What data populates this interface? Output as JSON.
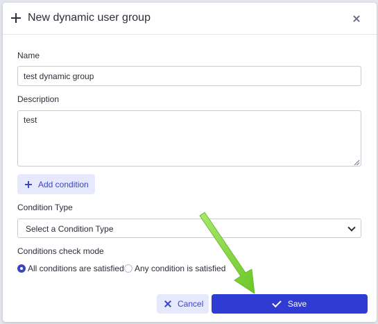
{
  "dialog": {
    "title": "New dynamic user group",
    "close_icon": "close-icon",
    "header_icon": "plus-icon"
  },
  "form": {
    "name_label": "Name",
    "name_value": "test dynamic group",
    "description_label": "Description",
    "description_value": "test",
    "add_condition_label": "Add condition",
    "condition_type_label": "Condition Type",
    "condition_type_selected": "Select a Condition Type",
    "check_mode_label": "Conditions check mode",
    "check_mode_options": [
      {
        "label": "All conditions are satisfied",
        "checked": true
      },
      {
        "label": "Any condition is satisfied",
        "checked": false
      }
    ]
  },
  "footer": {
    "cancel_label": "Cancel",
    "save_label": "Save"
  },
  "colors": {
    "accent": "#2f3bd2",
    "accent_light": "#e6e9fb",
    "annotation_arrow": "#7dd43a"
  }
}
